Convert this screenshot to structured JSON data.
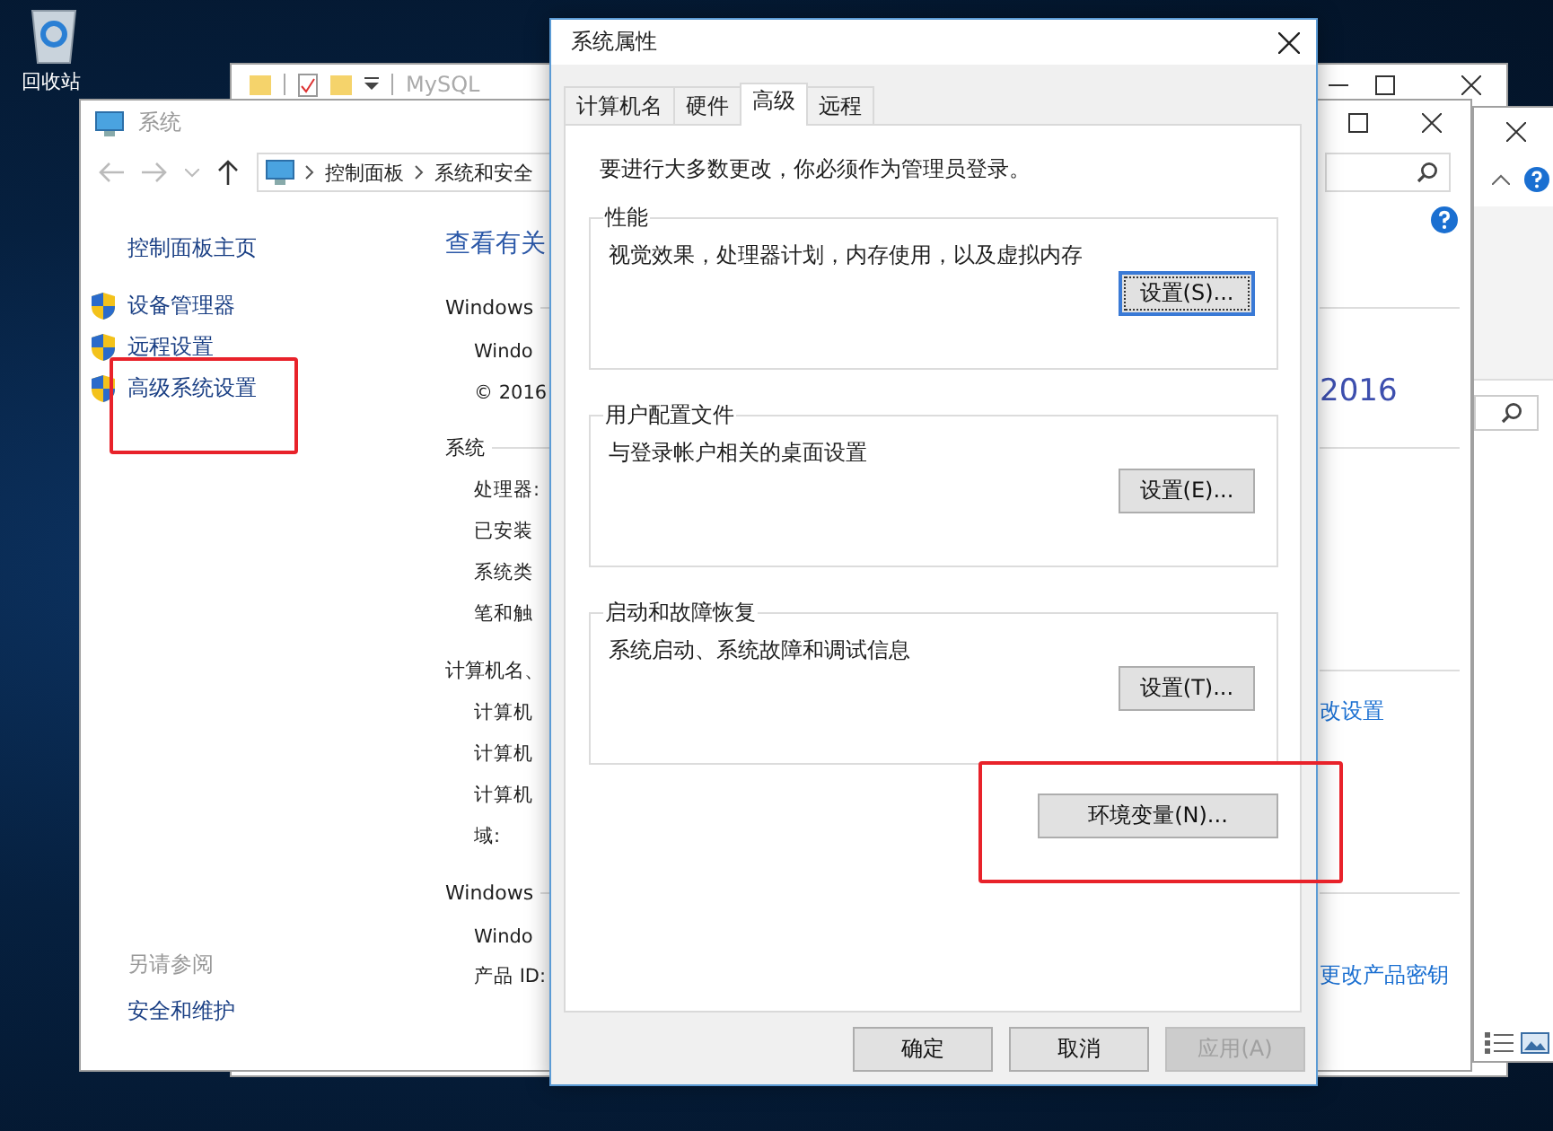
{
  "desktop": {
    "icon_label": "回收站"
  },
  "explorer_window": {
    "title": "MySQL"
  },
  "system_window": {
    "title": "系统",
    "breadcrumb": [
      "控制面板",
      "系统和安全"
    ],
    "nav_links": [
      {
        "label": "控制面板主页",
        "kind": "plain",
        "highlighted": false
      },
      {
        "label": "设备管理器",
        "kind": "shield",
        "highlighted": false
      },
      {
        "label": "远程设置",
        "kind": "shield",
        "highlighted": false
      },
      {
        "label": "高级系统设置",
        "kind": "shield",
        "highlighted": true
      }
    ],
    "see_also": {
      "heading": "另请参阅",
      "links": [
        "安全和维护"
      ]
    },
    "heading": "查看有关",
    "sections": [
      {
        "title": "Windows",
        "rows": [
          {
            "label": "Windo"
          },
          {
            "label": "© 2016",
            "aside": {
              "kind": "logo",
              "text": "2016"
            }
          }
        ]
      },
      {
        "title": "系统",
        "rows": [
          {
            "label": "处理器:"
          },
          {
            "label": "已安装"
          },
          {
            "label": "系统类"
          },
          {
            "label": "笔和触"
          }
        ]
      },
      {
        "title": "计算机名、",
        "rows": [
          {
            "label": "计算机",
            "aside": {
              "kind": "link",
              "text": "改设置"
            }
          },
          {
            "label": "计算机"
          },
          {
            "label": "计算机"
          },
          {
            "label": "域:"
          }
        ]
      },
      {
        "title": "Windows",
        "rows": [
          {
            "label": "Windo"
          },
          {
            "label": "产品 ID:",
            "aside": {
              "kind": "link",
              "text": "更改产品密钥"
            }
          }
        ]
      }
    ]
  },
  "dialog": {
    "title": "系统属性",
    "tabs": [
      {
        "label": "计算机名",
        "selected": false
      },
      {
        "label": "硬件",
        "selected": false
      },
      {
        "label": "高级",
        "selected": true
      },
      {
        "label": "远程",
        "selected": false
      }
    ],
    "note": "要进行大多数更改，你必须作为管理员登录。",
    "groups": [
      {
        "title": "性能",
        "description": "视觉效果，处理器计划，内存使用，以及虚拟内存",
        "button": "设置(S)...",
        "focused": true
      },
      {
        "title": "用户配置文件",
        "description": "与登录帐户相关的桌面设置",
        "button": "设置(E)...",
        "focused": false
      },
      {
        "title": "启动和故障恢复",
        "description": "系统启动、系统故障和调试信息",
        "button": "设置(T)...",
        "focused": false
      }
    ],
    "env_button": {
      "label": "环境变量(N)...",
      "highlighted": true
    },
    "footer_buttons": [
      {
        "label": "确定",
        "disabled": false
      },
      {
        "label": "取消",
        "disabled": false
      },
      {
        "label": "应用(A)",
        "disabled": true
      }
    ]
  }
}
